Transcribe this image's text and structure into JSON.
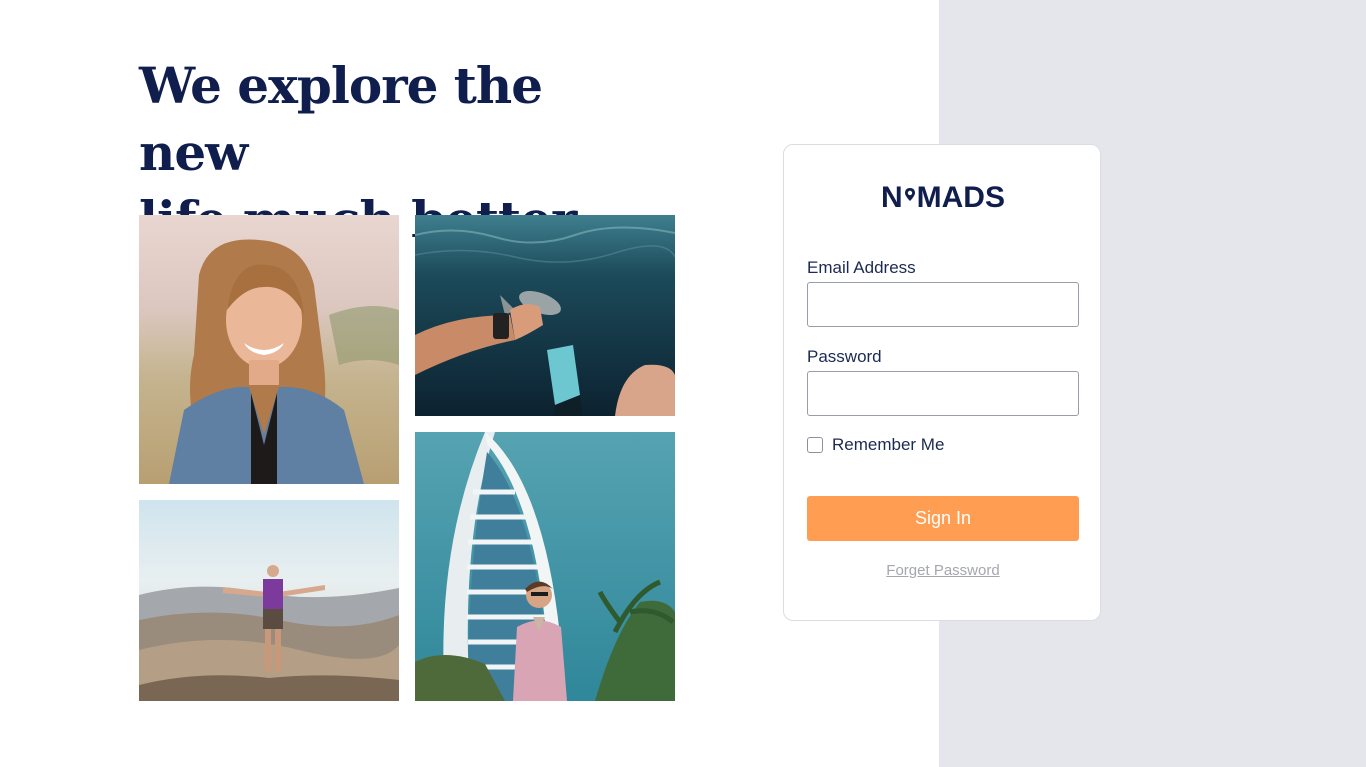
{
  "hero": {
    "headline_line1": "We explore the new",
    "headline_line2": "life much better"
  },
  "gallery": {
    "photos": [
      {
        "name": "woman-smiling-denim-jacket"
      },
      {
        "name": "underwater-snorkel-hand-reaching"
      },
      {
        "name": "man-arms-open-on-mountain"
      },
      {
        "name": "man-in-front-of-sail-shaped-hotel"
      }
    ]
  },
  "login": {
    "logo_left": "N",
    "logo_right": "MADS",
    "logo_icon": "location-pin-icon",
    "email_label": "Email Address",
    "email_value": "",
    "password_label": "Password",
    "password_value": "",
    "remember_label": "Remember Me",
    "remember_checked": false,
    "signin_label": "Sign In",
    "forget_label": "Forget Password"
  },
  "colors": {
    "brand_navy": "#0f1e4d",
    "accent_orange": "#ff9e53",
    "side_panel": "#e5e6ec",
    "muted_link": "#a5a7ae"
  }
}
